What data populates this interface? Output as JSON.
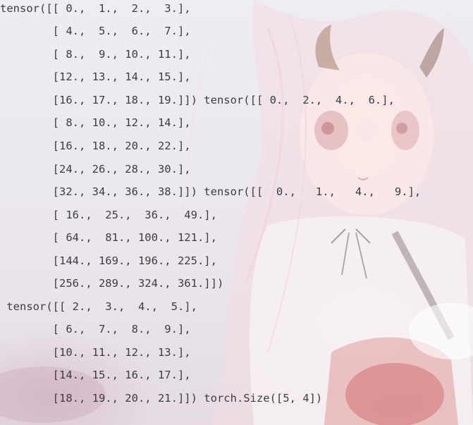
{
  "console": {
    "lines": [
      "tensor([[ 0.,  1.,  2.,  3.],",
      "        [ 4.,  5.,  6.,  7.],",
      "        [ 8.,  9., 10., 11.],",
      "        [12., 13., 14., 15.],",
      "        [16., 17., 18., 19.]]) tensor([[ 0.,  2.,  4.,  6.],",
      "        [ 8., 10., 12., 14.],",
      "        [16., 18., 20., 22.],",
      "        [24., 26., 28., 30.],",
      "        [32., 34., 36., 38.]]) tensor([[  0.,   1.,   4.,   9.],",
      "        [ 16.,  25.,  36.,  49.],",
      "        [ 64.,  81., 100., 121.],",
      "        [144., 169., 196., 225.],",
      "        [256., 289., 324., 361.]])",
      " tensor([[ 2.,  3.,  4.,  5.],",
      "        [ 6.,  7.,  8.,  9.],",
      "        [10., 11., 12., 13.],",
      "        [14., 15., 16., 17.],",
      "        [18., 19., 20., 21.]]) torch.Size([5, 4])"
    ]
  },
  "theme": {
    "text_color": "#3c3c44",
    "background_color": "#eeeaf0",
    "accent_color": "#c84a4a"
  }
}
